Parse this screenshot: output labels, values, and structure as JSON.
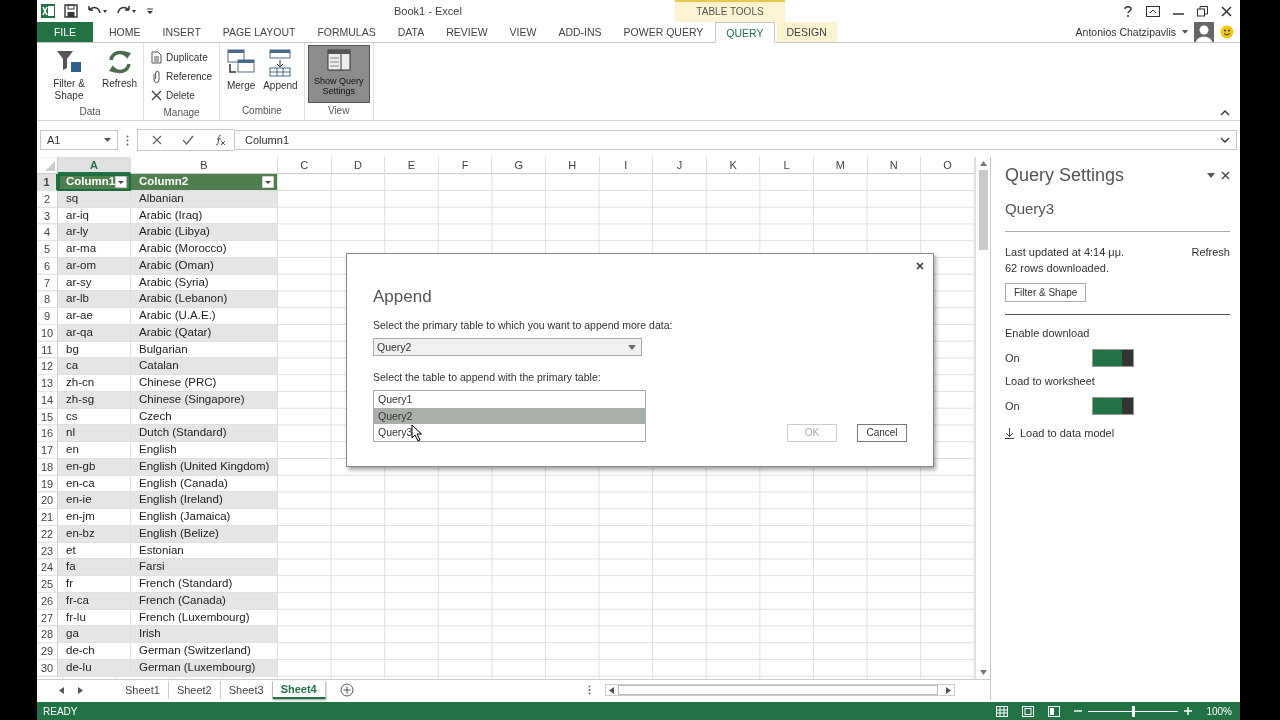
{
  "title_bar": {
    "title": "Book1 - Excel",
    "context_label": "TABLE TOOLS",
    "user": "Antonios Chatzipavlis"
  },
  "tabs": [
    {
      "label": "FILE",
      "kind": "file",
      "selected": false
    },
    {
      "label": "HOME",
      "kind": "normal",
      "selected": false
    },
    {
      "label": "INSERT",
      "kind": "normal",
      "selected": false
    },
    {
      "label": "PAGE LAYOUT",
      "kind": "normal",
      "selected": false
    },
    {
      "label": "FORMULAS",
      "kind": "normal",
      "selected": false
    },
    {
      "label": "DATA",
      "kind": "normal",
      "selected": false
    },
    {
      "label": "REVIEW",
      "kind": "normal",
      "selected": false
    },
    {
      "label": "VIEW",
      "kind": "normal",
      "selected": false
    },
    {
      "label": "ADD-INS",
      "kind": "normal",
      "selected": false
    },
    {
      "label": "POWER QUERY",
      "kind": "normal",
      "selected": false
    },
    {
      "label": "QUERY",
      "kind": "contextual",
      "selected": true
    },
    {
      "label": "DESIGN",
      "kind": "contextual",
      "selected": false
    }
  ],
  "ribbon": {
    "groups": [
      {
        "label": "Data",
        "kind": "large",
        "buttons": [
          {
            "label": "Filter & Shape",
            "selected": false
          },
          {
            "label": "Refresh",
            "selected": false
          }
        ]
      },
      {
        "label": "Manage",
        "kind": "small",
        "buttons": [
          {
            "label": "Duplicate",
            "selected": false
          },
          {
            "label": "Reference",
            "selected": false
          },
          {
            "label": "Delete",
            "selected": false
          }
        ]
      },
      {
        "label": "Combine",
        "kind": "large",
        "buttons": [
          {
            "label": "Merge",
            "selected": false
          },
          {
            "label": "Append",
            "selected": false
          }
        ]
      },
      {
        "label": "View",
        "kind": "large",
        "buttons": [
          {
            "label": "Show Query Settings",
            "selected": true
          }
        ]
      }
    ]
  },
  "formula_bar": {
    "name_box": "A1",
    "formula": "Column1"
  },
  "columns": [
    {
      "label": "A",
      "selected": true
    },
    {
      "label": "B",
      "selected": false
    },
    {
      "label": "C",
      "selected": false
    },
    {
      "label": "D",
      "selected": false
    },
    {
      "label": "E",
      "selected": false
    },
    {
      "label": "F",
      "selected": false
    },
    {
      "label": "G",
      "selected": false
    },
    {
      "label": "H",
      "selected": false
    },
    {
      "label": "I",
      "selected": false
    },
    {
      "label": "J",
      "selected": false
    },
    {
      "label": "K",
      "selected": false
    },
    {
      "label": "L",
      "selected": false
    },
    {
      "label": "M",
      "selected": false
    },
    {
      "label": "N",
      "selected": false
    },
    {
      "label": "O",
      "selected": false
    }
  ],
  "table": {
    "header_row": {
      "number": "1",
      "selected": true,
      "cells": [
        "Column1",
        "Column2"
      ]
    },
    "rows": [
      {
        "number": "2",
        "cells": [
          "sq",
          "Albanian"
        ]
      },
      {
        "number": "3",
        "cells": [
          "ar-iq",
          "Arabic (Iraq)"
        ]
      },
      {
        "number": "4",
        "cells": [
          "ar-ly",
          "Arabic (Libya)"
        ]
      },
      {
        "number": "5",
        "cells": [
          "ar-ma",
          "Arabic (Morocco)"
        ]
      },
      {
        "number": "6",
        "cells": [
          "ar-om",
          "Arabic (Oman)"
        ]
      },
      {
        "number": "7",
        "cells": [
          "ar-sy",
          "Arabic (Syria)"
        ]
      },
      {
        "number": "8",
        "cells": [
          "ar-lb",
          "Arabic (Lebanon)"
        ]
      },
      {
        "number": "9",
        "cells": [
          "ar-ae",
          "Arabic (U.A.E.)"
        ]
      },
      {
        "number": "10",
        "cells": [
          "ar-qa",
          "Arabic (Qatar)"
        ]
      },
      {
        "number": "11",
        "cells": [
          "bg",
          "Bulgarian"
        ]
      },
      {
        "number": "12",
        "cells": [
          "ca",
          "Catalan"
        ]
      },
      {
        "number": "13",
        "cells": [
          "zh-cn",
          "Chinese (PRC)"
        ]
      },
      {
        "number": "14",
        "cells": [
          "zh-sg",
          "Chinese (Singapore)"
        ]
      },
      {
        "number": "15",
        "cells": [
          "cs",
          "Czech"
        ]
      },
      {
        "number": "16",
        "cells": [
          "nl",
          "Dutch (Standard)"
        ]
      },
      {
        "number": "17",
        "cells": [
          "en",
          "English"
        ]
      },
      {
        "number": "18",
        "cells": [
          "en-gb",
          "English (United Kingdom)"
        ]
      },
      {
        "number": "19",
        "cells": [
          "en-ca",
          "English (Canada)"
        ]
      },
      {
        "number": "20",
        "cells": [
          "en-ie",
          "English (Ireland)"
        ]
      },
      {
        "number": "21",
        "cells": [
          "en-jm",
          "English (Jamaica)"
        ]
      },
      {
        "number": "22",
        "cells": [
          "en-bz",
          "English (Belize)"
        ]
      },
      {
        "number": "23",
        "cells": [
          "et",
          "Estonian"
        ]
      },
      {
        "number": "24",
        "cells": [
          "fa",
          "Farsi"
        ]
      },
      {
        "number": "25",
        "cells": [
          "fr",
          "French (Standard)"
        ]
      },
      {
        "number": "26",
        "cells": [
          "fr-ca",
          "French (Canada)"
        ]
      },
      {
        "number": "27",
        "cells": [
          "fr-lu",
          "French (Luxembourg)"
        ]
      },
      {
        "number": "28",
        "cells": [
          "ga",
          "Irish"
        ]
      },
      {
        "number": "29",
        "cells": [
          "de-ch",
          "German (Switzerland)"
        ]
      },
      {
        "number": "30",
        "cells": [
          "de-lu",
          "German (Luxembourg)"
        ]
      }
    ]
  },
  "sheets": [
    {
      "label": "Sheet1",
      "selected": false
    },
    {
      "label": "Sheet2",
      "selected": false
    },
    {
      "label": "Sheet3",
      "selected": false
    },
    {
      "label": "Sheet4",
      "selected": true
    }
  ],
  "status_bar": {
    "status": "READY",
    "zoom": "100%",
    "level": 0.5
  },
  "dialog": {
    "title": "Append",
    "primary_label": "Select the primary table to which you want to append more data:",
    "primary_value": "Query2",
    "secondary_label": "Select the table to append with the primary table:",
    "items": [
      {
        "label": "Query1",
        "selected": false
      },
      {
        "label": "Query2",
        "selected": true
      },
      {
        "label": "Query3",
        "selected": false
      }
    ],
    "buttons": [
      {
        "label": "OK",
        "disabled": true
      },
      {
        "label": "Cancel",
        "disabled": false
      }
    ]
  },
  "panel": {
    "title": "Query Settings",
    "query": "Query3",
    "last_updated": "Last updated at 4:14 μμ.",
    "refresh": "Refresh",
    "rows_info": "62 rows downloaded.",
    "filter_button": "Filter & Shape",
    "toggles": [
      {
        "label": "Enable download",
        "state_text": "On",
        "on": true
      },
      {
        "label": "Load to worksheet",
        "state_text": "On",
        "on": true
      }
    ],
    "load_link": "Load to data model"
  }
}
